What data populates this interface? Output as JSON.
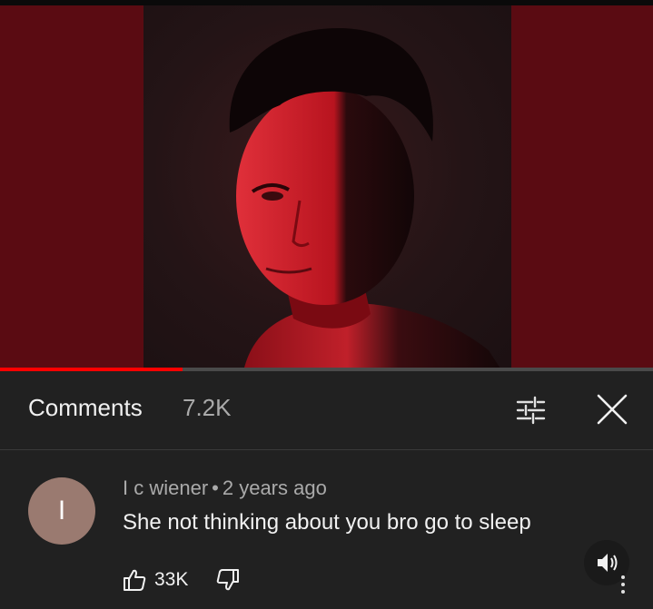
{
  "video": {
    "progress_fraction": 0.28,
    "colors": {
      "letterbox": "#5a0b12",
      "progress": "#ff0000"
    }
  },
  "comments_header": {
    "title": "Comments",
    "count": "7.2K",
    "filter_icon": "filter-sliders-icon",
    "close_icon": "close-icon"
  },
  "comment": {
    "avatar_letter": "I",
    "author": "I c wiener",
    "separator": "•",
    "time": "2 years ago",
    "text": "She not thinking about you bro go to sleep",
    "like_count": "33K",
    "like_icon": "thumbs-up-icon",
    "dislike_icon": "thumbs-down-icon"
  },
  "overlay": {
    "sound_icon": "speaker-volume-icon",
    "more_icon": "more-vertical-icon"
  }
}
